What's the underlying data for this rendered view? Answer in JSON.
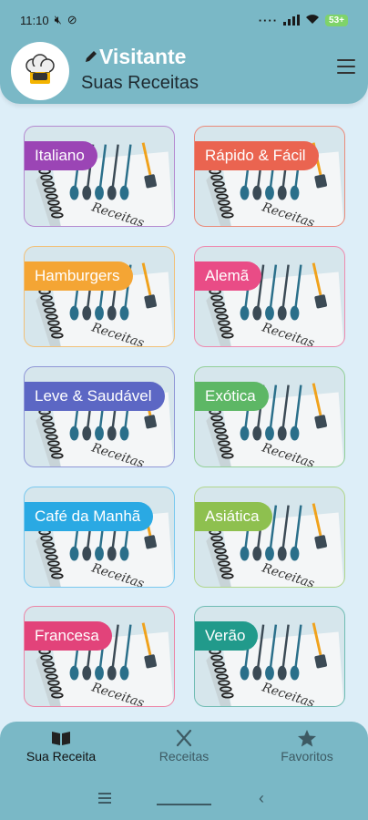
{
  "status": {
    "time": "11:10",
    "battery": "53"
  },
  "header": {
    "user_name": "Visitante",
    "subtitle": "Suas Receitas"
  },
  "categories": [
    {
      "label": "Italiano",
      "color": "#9b45b5",
      "border": "#b58ad0"
    },
    {
      "label": "Rápido & Fácil",
      "color": "#ea6450",
      "border": "#ea8a7a"
    },
    {
      "label": "Hamburgers",
      "color": "#f4a534",
      "border": "#f1c078"
    },
    {
      "label": "Alemã",
      "color": "#e94c86",
      "border": "#ee8aaf"
    },
    {
      "label": "Leve & Saudável",
      "color": "#5c67c4",
      "border": "#8f96d6"
    },
    {
      "label": "Exótica",
      "color": "#5db765",
      "border": "#93cf98"
    },
    {
      "label": "Café da Manhã",
      "color": "#2aa9e3",
      "border": "#79c8ee"
    },
    {
      "label": "Asiática",
      "color": "#8ec04f",
      "border": "#b1d68c"
    },
    {
      "label": "Francesa",
      "color": "#e2437a",
      "border": "#ec85a6"
    },
    {
      "label": "Verão",
      "color": "#219a8b",
      "border": "#70bcb3"
    }
  ],
  "notebook_text": "Receitas",
  "nav": [
    {
      "label": "Sua Receita",
      "icon": "book-icon",
      "active": true
    },
    {
      "label": "Receitas",
      "icon": "utensils-icon",
      "active": false
    },
    {
      "label": "Favoritos",
      "icon": "star-icon",
      "active": false
    }
  ]
}
